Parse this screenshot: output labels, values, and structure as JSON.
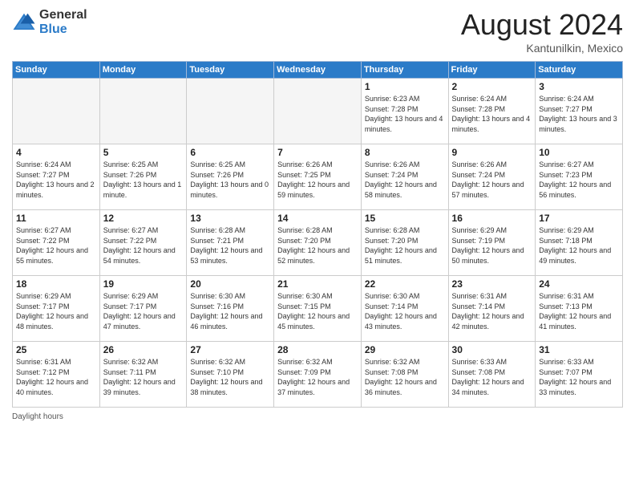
{
  "logo": {
    "general": "General",
    "blue": "Blue"
  },
  "title": "August 2024",
  "location": "Kantunilkin, Mexico",
  "days_of_week": [
    "Sunday",
    "Monday",
    "Tuesday",
    "Wednesday",
    "Thursday",
    "Friday",
    "Saturday"
  ],
  "weeks": [
    [
      {
        "day": "",
        "empty": true
      },
      {
        "day": "",
        "empty": true
      },
      {
        "day": "",
        "empty": true
      },
      {
        "day": "",
        "empty": true
      },
      {
        "day": "1",
        "sunrise": "6:23 AM",
        "sunset": "7:28 PM",
        "daylight": "13 hours and 4 minutes."
      },
      {
        "day": "2",
        "sunrise": "6:24 AM",
        "sunset": "7:28 PM",
        "daylight": "13 hours and 4 minutes."
      },
      {
        "day": "3",
        "sunrise": "6:24 AM",
        "sunset": "7:27 PM",
        "daylight": "13 hours and 3 minutes."
      }
    ],
    [
      {
        "day": "4",
        "sunrise": "6:24 AM",
        "sunset": "7:27 PM",
        "daylight": "13 hours and 2 minutes."
      },
      {
        "day": "5",
        "sunrise": "6:25 AM",
        "sunset": "7:26 PM",
        "daylight": "13 hours and 1 minute."
      },
      {
        "day": "6",
        "sunrise": "6:25 AM",
        "sunset": "7:26 PM",
        "daylight": "13 hours and 0 minutes."
      },
      {
        "day": "7",
        "sunrise": "6:26 AM",
        "sunset": "7:25 PM",
        "daylight": "12 hours and 59 minutes."
      },
      {
        "day": "8",
        "sunrise": "6:26 AM",
        "sunset": "7:24 PM",
        "daylight": "12 hours and 58 minutes."
      },
      {
        "day": "9",
        "sunrise": "6:26 AM",
        "sunset": "7:24 PM",
        "daylight": "12 hours and 57 minutes."
      },
      {
        "day": "10",
        "sunrise": "6:27 AM",
        "sunset": "7:23 PM",
        "daylight": "12 hours and 56 minutes."
      }
    ],
    [
      {
        "day": "11",
        "sunrise": "6:27 AM",
        "sunset": "7:22 PM",
        "daylight": "12 hours and 55 minutes."
      },
      {
        "day": "12",
        "sunrise": "6:27 AM",
        "sunset": "7:22 PM",
        "daylight": "12 hours and 54 minutes."
      },
      {
        "day": "13",
        "sunrise": "6:28 AM",
        "sunset": "7:21 PM",
        "daylight": "12 hours and 53 minutes."
      },
      {
        "day": "14",
        "sunrise": "6:28 AM",
        "sunset": "7:20 PM",
        "daylight": "12 hours and 52 minutes."
      },
      {
        "day": "15",
        "sunrise": "6:28 AM",
        "sunset": "7:20 PM",
        "daylight": "12 hours and 51 minutes."
      },
      {
        "day": "16",
        "sunrise": "6:29 AM",
        "sunset": "7:19 PM",
        "daylight": "12 hours and 50 minutes."
      },
      {
        "day": "17",
        "sunrise": "6:29 AM",
        "sunset": "7:18 PM",
        "daylight": "12 hours and 49 minutes."
      }
    ],
    [
      {
        "day": "18",
        "sunrise": "6:29 AM",
        "sunset": "7:17 PM",
        "daylight": "12 hours and 48 minutes."
      },
      {
        "day": "19",
        "sunrise": "6:29 AM",
        "sunset": "7:17 PM",
        "daylight": "12 hours and 47 minutes."
      },
      {
        "day": "20",
        "sunrise": "6:30 AM",
        "sunset": "7:16 PM",
        "daylight": "12 hours and 46 minutes."
      },
      {
        "day": "21",
        "sunrise": "6:30 AM",
        "sunset": "7:15 PM",
        "daylight": "12 hours and 45 minutes."
      },
      {
        "day": "22",
        "sunrise": "6:30 AM",
        "sunset": "7:14 PM",
        "daylight": "12 hours and 43 minutes."
      },
      {
        "day": "23",
        "sunrise": "6:31 AM",
        "sunset": "7:14 PM",
        "daylight": "12 hours and 42 minutes."
      },
      {
        "day": "24",
        "sunrise": "6:31 AM",
        "sunset": "7:13 PM",
        "daylight": "12 hours and 41 minutes."
      }
    ],
    [
      {
        "day": "25",
        "sunrise": "6:31 AM",
        "sunset": "7:12 PM",
        "daylight": "12 hours and 40 minutes."
      },
      {
        "day": "26",
        "sunrise": "6:32 AM",
        "sunset": "7:11 PM",
        "daylight": "12 hours and 39 minutes."
      },
      {
        "day": "27",
        "sunrise": "6:32 AM",
        "sunset": "7:10 PM",
        "daylight": "12 hours and 38 minutes."
      },
      {
        "day": "28",
        "sunrise": "6:32 AM",
        "sunset": "7:09 PM",
        "daylight": "12 hours and 37 minutes."
      },
      {
        "day": "29",
        "sunrise": "6:32 AM",
        "sunset": "7:08 PM",
        "daylight": "12 hours and 36 minutes."
      },
      {
        "day": "30",
        "sunrise": "6:33 AM",
        "sunset": "7:08 PM",
        "daylight": "12 hours and 34 minutes."
      },
      {
        "day": "31",
        "sunrise": "6:33 AM",
        "sunset": "7:07 PM",
        "daylight": "12 hours and 33 minutes."
      }
    ]
  ],
  "footer": "Daylight hours"
}
